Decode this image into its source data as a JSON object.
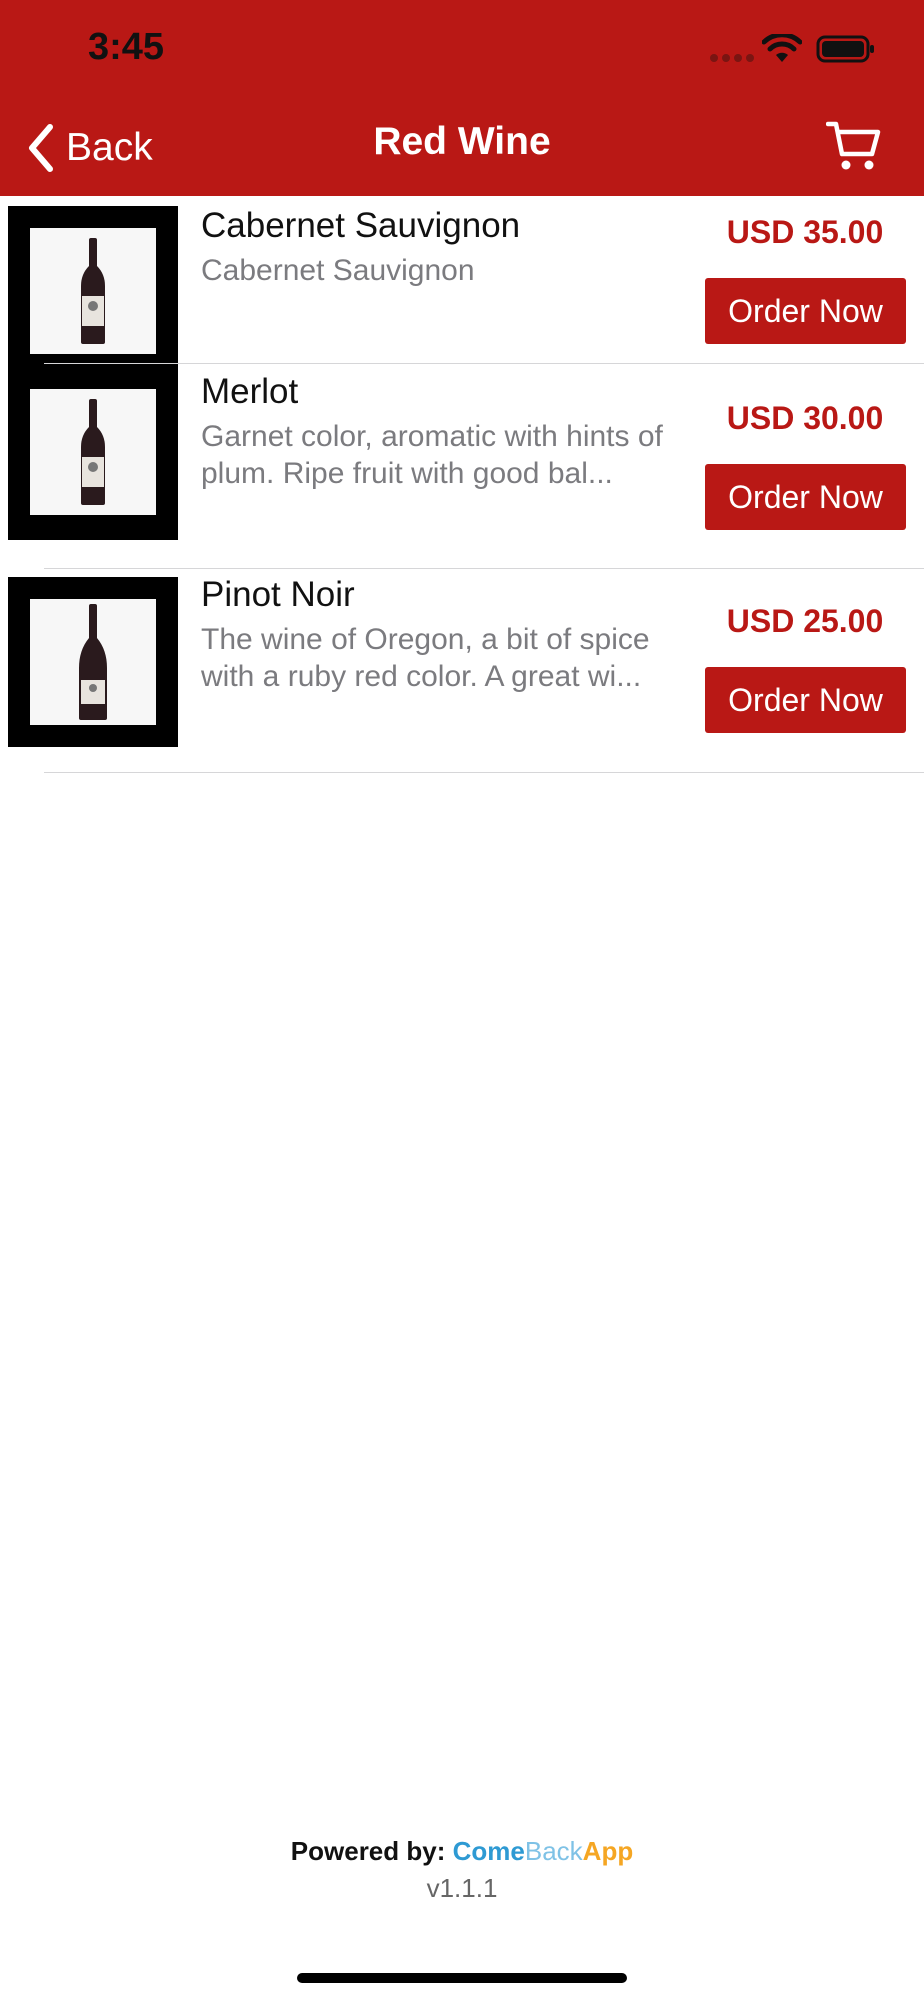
{
  "status_bar": {
    "time": "3:45"
  },
  "nav": {
    "back_label": "Back",
    "title": "Red Wine",
    "cart_icon": "cart-icon"
  },
  "products": [
    {
      "name": "Cabernet Sauvignon",
      "description": "Cabernet Sauvignon",
      "price": "USD 35.00",
      "button": "Order Now"
    },
    {
      "name": "Merlot",
      "description": "Garnet color, aromatic with hints of plum. Ripe fruit with good bal...",
      "price": "USD 30.00",
      "button": "Order Now"
    },
    {
      "name": "Pinot Noir",
      "description": "The wine of Oregon, a bit of spice with a ruby red color. A great wi...",
      "price": "USD 25.00",
      "button": "Order Now"
    }
  ],
  "footer": {
    "powered_by": "Powered by:",
    "brand_come": "Come",
    "brand_back": "Back",
    "brand_app": "App",
    "version": "v1.1.1"
  },
  "colors": {
    "accent": "#b91815",
    "brand_blue": "#2e9ad3",
    "brand_light_blue": "#7fc2e6",
    "brand_orange": "#f5a623"
  }
}
